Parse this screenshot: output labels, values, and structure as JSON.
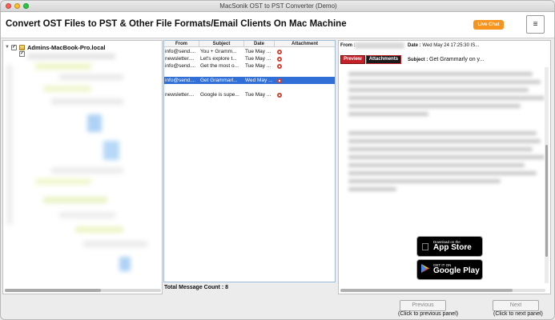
{
  "window": {
    "title": "MacSonik OST to PST Converter (Demo)"
  },
  "header": {
    "heading": "Convert OST Files to PST & Other File Formats/Email Clients On Mac Machine",
    "live_chat": "Live Chat",
    "menu_icon": "hamburger-icon",
    "menu_glyph": "≡"
  },
  "tree": {
    "root_label": "Admins-MacBook-Pro.local",
    "root_checked": "✓",
    "sub_checked": "✓",
    "arrow": "▼"
  },
  "messages": {
    "columns": {
      "from": "From",
      "subject": "Subject",
      "date": "Date",
      "attachment": "Attachment"
    },
    "rows": [
      {
        "from": "info@send....",
        "subject": "You + Gramm...",
        "date": "Tue May ...",
        "attachment": true,
        "selected": false
      },
      {
        "from": "newsletter....",
        "subject": "Let's explore t...",
        "date": "Tue May ...",
        "attachment": true,
        "selected": false
      },
      {
        "from": "info@send....",
        "subject": "Get the most o...",
        "date": "Tue May ...",
        "attachment": true,
        "selected": false
      },
      {
        "from": "",
        "subject": "",
        "date": "",
        "attachment": false,
        "selected": false
      },
      {
        "from": "info@send....",
        "subject": "Get Grammarl...",
        "date": "Wed May ...",
        "attachment": true,
        "selected": true
      },
      {
        "from": "",
        "subject": "",
        "date": "",
        "attachment": false,
        "selected": false
      },
      {
        "from": "newsletter....",
        "subject": "Google is supe...",
        "date": "Tue May ...",
        "attachment": true,
        "selected": false
      }
    ],
    "count_text": "Total Message Count : 8"
  },
  "preview": {
    "from_label": "From :",
    "date_label": "Date :",
    "date_value": "Wed May 24 17:25:30 IS...",
    "subject_label": "Subject :",
    "subject_value": "Get Grammarly on y...",
    "tab_preview": "Preview",
    "tab_attachments": "Attachments",
    "app_store": {
      "small": "Download on the",
      "big": "App Store",
      "icon": "apple-icon"
    },
    "google_play": {
      "small": "GET IT ON",
      "big": "Google Play",
      "icon": "play-icon"
    }
  },
  "nav": {
    "previous_label": "Previous",
    "previous_hint": "(Click to previous panel)",
    "next_label": "Next",
    "next_hint": "(Click to next panel)"
  }
}
